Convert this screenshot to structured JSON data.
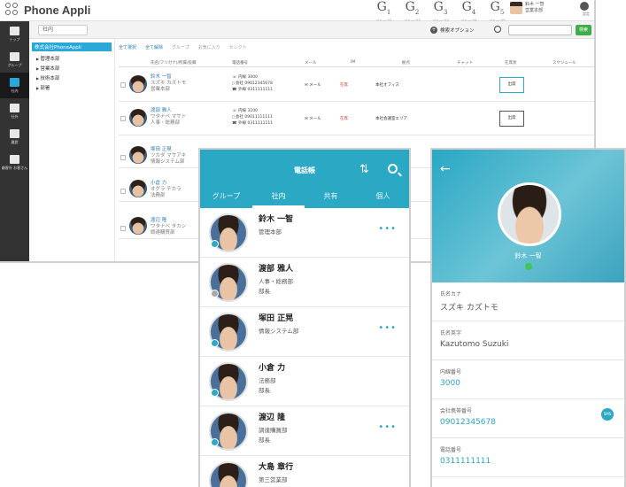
{
  "app": {
    "title": "Phone Appli"
  },
  "groups": [
    {
      "code": "G",
      "num": "1",
      "label": "グループ1"
    },
    {
      "code": "G",
      "num": "2",
      "label": "グループ2"
    },
    {
      "code": "G",
      "num": "3",
      "label": "グループ3"
    },
    {
      "code": "G",
      "num": "4",
      "label": "グループ4"
    },
    {
      "code": "G",
      "num": "5",
      "label": "グループ5"
    }
  ],
  "user": {
    "name": "鈴木 一智",
    "sub": "営業本部"
  },
  "settings_label": "設定",
  "sidebar": [
    {
      "label": "トップ",
      "icon": "home-icon"
    },
    {
      "label": "グループ",
      "icon": "group-icon"
    },
    {
      "label": "社内",
      "icon": "org-icon",
      "active": true
    },
    {
      "label": "社外",
      "icon": "contact-card-icon"
    },
    {
      "label": "履歴",
      "icon": "history-icon"
    },
    {
      "label": "顧客外\nお客さん",
      "icon": "pin-icon"
    }
  ],
  "toolbar": {
    "breadcrumb": "社内",
    "advanced_option": "検索オプション",
    "search_button": "検索"
  },
  "tree": {
    "root": "株式会社PhoneAppli",
    "nodes": [
      "管理本部",
      "営業本部",
      "技術本部",
      "部署"
    ]
  },
  "table_actions": [
    "全て選択",
    "全て解除",
    "グループ",
    "お気に入り",
    "セレクト"
  ],
  "table_headers": [
    "氏名(フリガナ)/所属/役職",
    "電話番号",
    "メール",
    "IM",
    "拠点",
    "チャット",
    "在席状",
    "スケジュール"
  ],
  "desktop_rows": [
    {
      "name": "鈴木 一智",
      "kana": "スズキ カズトモ",
      "dept": "営業本部",
      "tel1": "3000",
      "tel2": "09012345678",
      "tel3": "0311111111",
      "mail": "メール",
      "status": "在席",
      "location": "本社オフィス",
      "presence": "出席"
    },
    {
      "name": "渡部 雅人",
      "kana": "ワタナベ マサト",
      "dept": "人事・総務部",
      "tel1": "3100",
      "tel2": "09011111111",
      "tel3": "0311111111",
      "mail": "メール",
      "status": "在席",
      "location": "本社会議室エリア",
      "presence": "出席"
    },
    {
      "name": "塚田 正晃",
      "kana": "ツカダ マサアキ",
      "dept": "情報システム部",
      "tel1": "",
      "tel2": "",
      "tel3": "",
      "mail": "",
      "status": "",
      "location": "",
      "presence": ""
    },
    {
      "name": "小倉 力",
      "kana": "オグラ チカラ",
      "dept": "法務部",
      "tel1": "",
      "tel2": "",
      "tel3": "",
      "mail": "",
      "status": "",
      "location": "",
      "presence": ""
    },
    {
      "name": "渡辺 隆",
      "kana": "ワタナベ タカシ",
      "dept": "調達購買部",
      "tel1": "",
      "tel2": "",
      "tel3": "",
      "mail": "",
      "status": "",
      "location": "",
      "presence": ""
    }
  ],
  "phone_list": {
    "title": "電話帳",
    "tabs": [
      "グループ",
      "社内",
      "共有",
      "個人"
    ],
    "active_tab": 1,
    "contacts": [
      {
        "name": "鈴木 一智",
        "dept": "管理本部",
        "title": "",
        "has_more": true
      },
      {
        "name": "渡部 雅人",
        "dept": "人事・総務部",
        "title": "部長",
        "has_more": false
      },
      {
        "name": "塚田 正晃",
        "dept": "情報システム部",
        "title": "",
        "has_more": true
      },
      {
        "name": "小倉 力",
        "dept": "法務部",
        "title": "部長",
        "has_more": false
      },
      {
        "name": "渡辺 隆",
        "dept": "調達購買部",
        "title": "部長",
        "has_more": true
      },
      {
        "name": "大島 章行",
        "dept": "第三営業部",
        "title": "",
        "has_more": false
      }
    ]
  },
  "phone_detail": {
    "name": "鈴木 一智",
    "fields": [
      {
        "label": "氏名カナ",
        "value": "スズキ カズトモ",
        "link": false
      },
      {
        "label": "氏名英字",
        "value": "Kazutomo Suzuki",
        "link": false
      },
      {
        "label": "内線番号",
        "value": "3000",
        "link": true
      },
      {
        "label": "会社携帯番号",
        "value": "09012345678",
        "link": true,
        "sms": "SMS"
      },
      {
        "label": "電話番号",
        "value": "0311111111",
        "link": true
      }
    ]
  }
}
